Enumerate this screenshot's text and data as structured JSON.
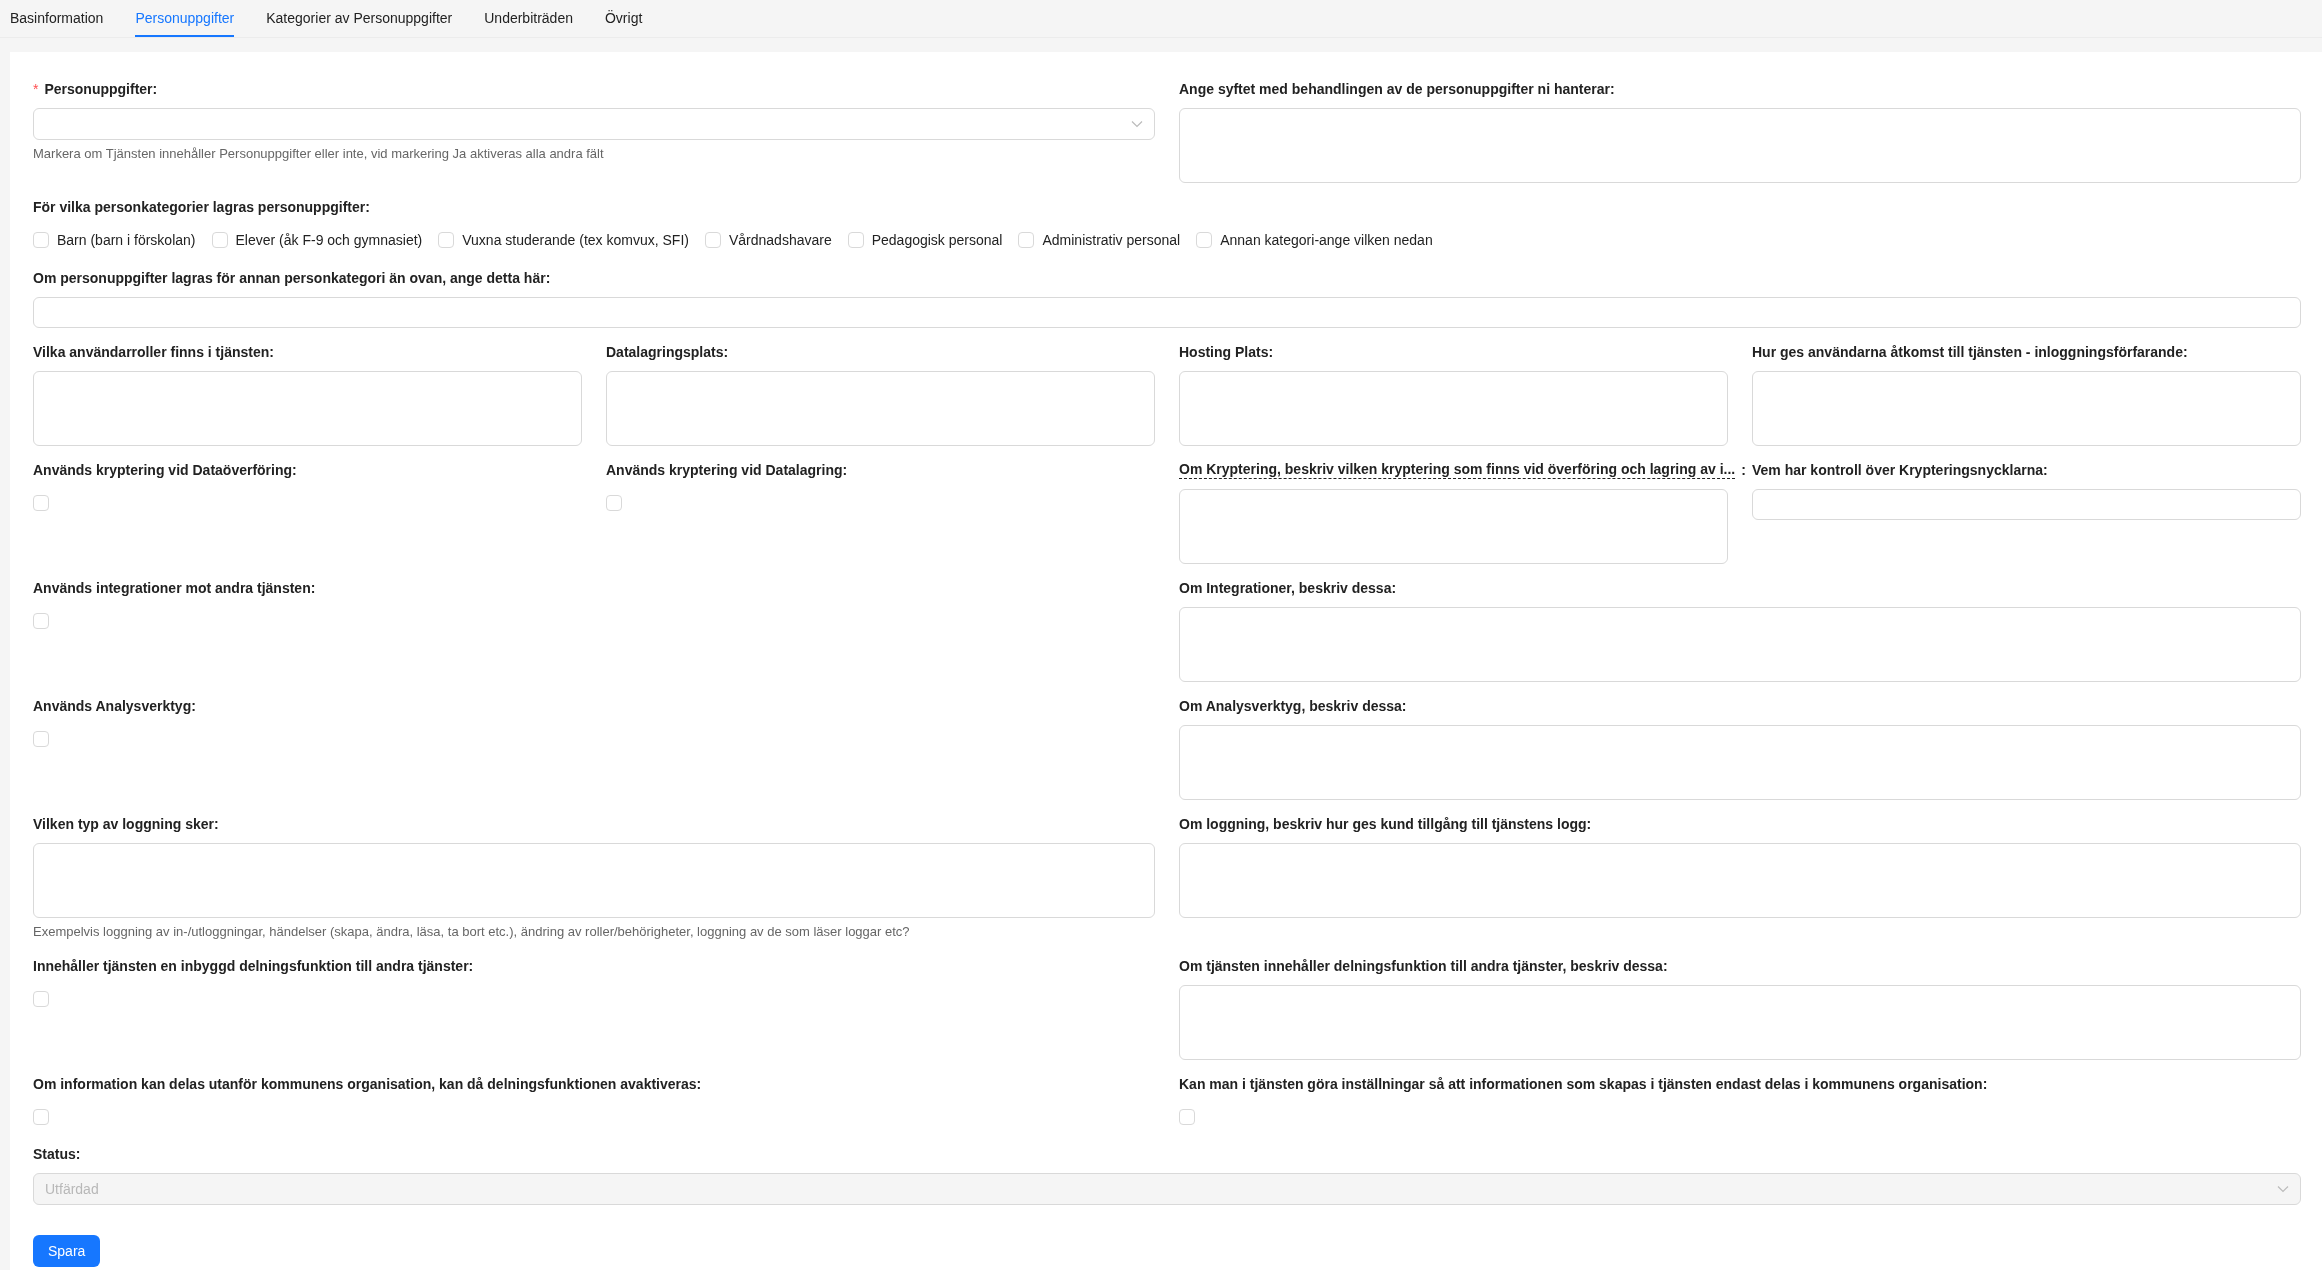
{
  "tabs": [
    {
      "label": "Basinformation",
      "selected": false
    },
    {
      "label": "Personuppgifter",
      "selected": true
    },
    {
      "label": "Kategorier av Personuppgifter",
      "selected": false
    },
    {
      "label": "Underbiträden",
      "selected": false
    },
    {
      "label": "Övrigt",
      "selected": false
    }
  ],
  "rows": [
    [
      {
        "kind": "select",
        "required_mark": "*",
        "label": "Personuppgifter:",
        "help": "Markera om Tjänsten innehåller Personuppgifter eller inte, vid markering Ja aktiveras alla andra fält"
      },
      {
        "kind": "textarea",
        "label": "Ange syftet med behandlingen av de personuppgifter ni hanterar:"
      }
    ],
    [
      {
        "kind": "checkgroup",
        "label": "För vilka personkategorier lagras personuppgifter:",
        "options": [
          {
            "label": "Barn (barn i förskolan)",
            "checked": false
          },
          {
            "label": "Elever (åk F-9 och gymnasiet)",
            "checked": false
          },
          {
            "label": "Vuxna studerande (tex komvux, SFI)",
            "checked": false
          },
          {
            "label": "Vårdnadshavare",
            "checked": false
          },
          {
            "label": "Pedagogisk personal",
            "checked": false
          },
          {
            "label": "Administrativ personal",
            "checked": false
          },
          {
            "label": "Annan kategori-ange vilken nedan",
            "checked": false
          }
        ]
      }
    ],
    [
      {
        "kind": "input",
        "label": "Om personuppgifter lagras för annan personkategori än ovan, ange detta här:"
      }
    ],
    [
      {
        "kind": "textarea",
        "label": "Vilka användarroller finns i tjänsten:"
      },
      {
        "kind": "textarea",
        "label": "Datalagringsplats:"
      },
      {
        "kind": "textarea",
        "label": "Hosting Plats:"
      },
      {
        "kind": "textarea",
        "label": "Hur ges användarna åtkomst till tjänsten - inloggningsförfarande:"
      }
    ],
    [
      {
        "kind": "checkbox",
        "label": "Används kryptering vid Dataöverföring:",
        "checked": false
      },
      {
        "kind": "checkbox",
        "label": "Används kryptering vid Datalagring:",
        "checked": false
      },
      {
        "kind": "textarea",
        "label": "Om Kryptering, beskriv vilken kryptering som finns vid överföring och lagring av i...",
        "tooltip": true,
        "colon": ":"
      },
      {
        "kind": "input",
        "label": "Vem har kontroll över Krypteringsnycklarna:"
      }
    ],
    [
      {
        "kind": "checkbox",
        "label": "Används integrationer mot andra tjänsten:",
        "checked": false
      },
      {
        "kind": "textarea",
        "label": "Om Integrationer, beskriv dessa:"
      }
    ],
    [
      {
        "kind": "checkbox",
        "label": "Används Analysverktyg:",
        "checked": false
      },
      {
        "kind": "textarea",
        "label": "Om Analysverktyg, beskriv dessa:"
      }
    ],
    [
      {
        "kind": "textarea",
        "label": "Vilken typ av loggning sker:",
        "help": "Exempelvis loggning av in-/utloggningar, händelser (skapa, ändra, läsa, ta bort etc.), ändring av roller/behörigheter, loggning av de som läser loggar etc?"
      },
      {
        "kind": "textarea",
        "label": "Om loggning, beskriv hur ges kund tillgång till tjänstens logg:"
      }
    ],
    [
      {
        "kind": "checkbox",
        "label": "Innehåller tjänsten en inbyggd delningsfunktion till andra tjänster:",
        "checked": false
      },
      {
        "kind": "textarea",
        "label": "Om tjänsten innehåller delningsfunktion till andra tjänster, beskriv dessa:"
      }
    ],
    [
      {
        "kind": "checkbox",
        "label": "Om information kan delas utanför kommunens organisation, kan då delningsfunktionen avaktiveras:",
        "checked": false
      },
      {
        "kind": "checkbox",
        "label": "Kan man i tjänsten göra inställningar så att informationen som skapas i tjänsten endast delas i kommunens organisation:",
        "checked": false
      }
    ],
    [
      {
        "kind": "select",
        "label": "Status:",
        "value": "Utfärdad",
        "disabled": true
      }
    ]
  ],
  "save_button": "Spara"
}
